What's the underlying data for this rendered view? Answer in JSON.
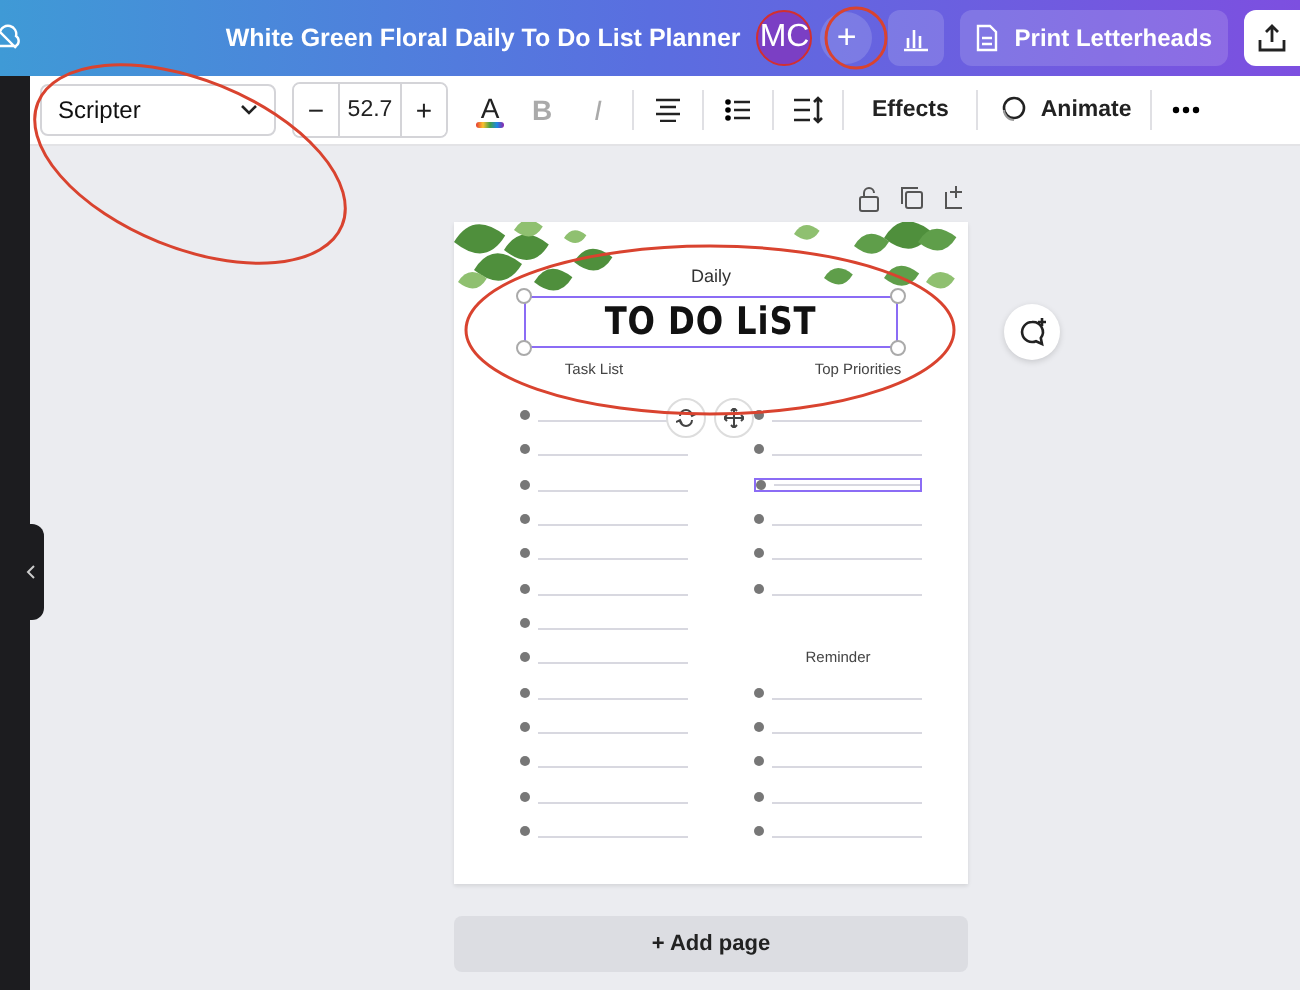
{
  "topbar": {
    "title": "White Green Floral Daily To Do List Planner",
    "avatar": "MC",
    "add": "+",
    "print_button": "Print Letterheads"
  },
  "toolbar": {
    "font": "Scripter",
    "minus": "−",
    "font_size": "52.7",
    "plus": "+",
    "text_color": "A",
    "bold": "B",
    "italic": "I",
    "effects": "Effects",
    "animate": "Animate"
  },
  "page": {
    "daily": "Daily",
    "heading": "TO DO LiST",
    "heading_selected": true,
    "task_list": {
      "title": "Task List",
      "items": [
        {
          "selected": false
        },
        {
          "selected": false
        },
        {
          "selected": false
        },
        {
          "selected": false
        },
        {
          "selected": false
        },
        {
          "selected": false
        },
        {
          "selected": false
        },
        {
          "selected": false
        },
        {
          "selected": false
        },
        {
          "selected": false
        },
        {
          "selected": false
        },
        {
          "selected": false
        },
        {
          "selected": false
        }
      ]
    },
    "priorities": {
      "title": "Top Priorities",
      "items": [
        {
          "selected": false
        },
        {
          "selected": false
        },
        {
          "selected": true
        },
        {
          "selected": false
        },
        {
          "selected": false
        },
        {
          "selected": false
        }
      ]
    },
    "reminder": {
      "title": "Reminder",
      "items": [
        {
          "selected": false
        },
        {
          "selected": false
        },
        {
          "selected": false
        },
        {
          "selected": false
        },
        {
          "selected": false
        }
      ]
    }
  },
  "add_page": "+ Add page"
}
